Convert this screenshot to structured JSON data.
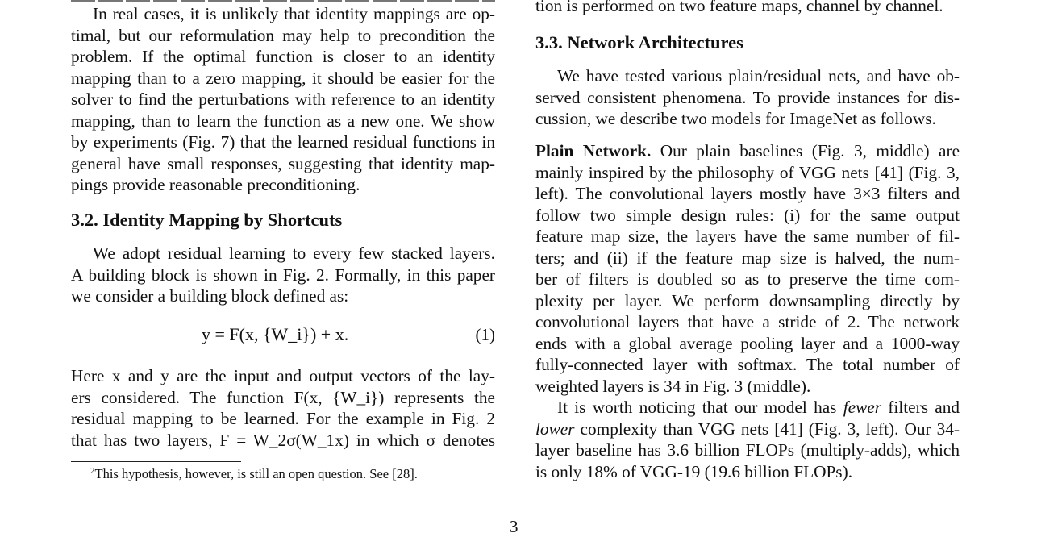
{
  "left_column": {
    "para1_lines": [
      "In real cases, it is unlikely that identity mappings are op-",
      "timal, but our reformulation may help to precondition the",
      "problem.  If the optimal function is closer to an identity",
      "mapping than to a zero mapping, it should be easier for the",
      "solver to find the perturbations with reference to an identity",
      "mapping, than to learn the function as a new one. We show",
      "by experiments (Fig. 7) that the learned residual functions in",
      "general have small responses, suggesting that identity map-",
      "pings provide reasonable preconditioning."
    ],
    "section_heading": "3.2. Identity Mapping by Shortcuts",
    "para2_lines": [
      "We adopt residual learning to every few stacked layers.",
      "A building block is shown in Fig. 2. Formally, in this paper",
      "we consider a building block defined as:"
    ],
    "equation": {
      "text": "y = F(x, {W_i}) + x.",
      "number": "(1)"
    },
    "para3": {
      "line1": "Here x and y are the input and output vectors of the lay-",
      "line2": "ers considered.  The function F(x, {W_i}) represents the",
      "line3": "residual mapping to be learned. For the example in Fig. 2",
      "line4": "that has two layers, F = W_2σ(W_1x) in which σ denotes"
    },
    "footnote": {
      "marker": "2",
      "text": "This hypothesis, however, is still an open question. See [28]."
    }
  },
  "right_column": {
    "cut_line": "tion is performed on two feature maps, channel by channel.",
    "section_heading": "3.3. Network Architectures",
    "para1_lines": [
      "We have tested various plain/residual nets, and have ob-",
      "served consistent phenomena. To provide instances for dis-",
      "cussion, we describe two models for ImageNet as follows."
    ],
    "plain_network": {
      "run_in_heading": "Plain Network.",
      "first_line_rest": "Our plain baselines (Fig. 3, middle) are",
      "lines": [
        "mainly inspired by the philosophy of VGG nets [41] (Fig. 3,",
        "left). The convolutional layers mostly have 3×3 filters and",
        "follow two simple design rules: (i) for the same output",
        "feature map size, the layers have the same number of fil-",
        "ters; and (ii) if the feature map size is halved, the num-",
        "ber of filters is doubled so as to preserve the time com-",
        "plexity per layer.  We perform downsampling directly by",
        "convolutional layers that have a stride of 2.  The network",
        "ends with a global average pooling layer and a 1000-way",
        "fully-connected layer with softmax.  The total number of",
        "weighted layers is 34 in Fig. 3 (middle)."
      ]
    },
    "para_fewer": {
      "line1_pre": "It is worth noticing that our model has ",
      "line1_em": "fewer",
      "line1_post": " filters and",
      "line2_em": "lower",
      "line2_post": " complexity than VGG nets [41] (Fig. 3, left). Our 34-",
      "line3": "layer baseline has 3.6 billion FLOPs (multiply-adds), which",
      "line4": "is only 18% of VGG-19 (19.6 billion FLOPs)."
    }
  },
  "page_number": "3"
}
